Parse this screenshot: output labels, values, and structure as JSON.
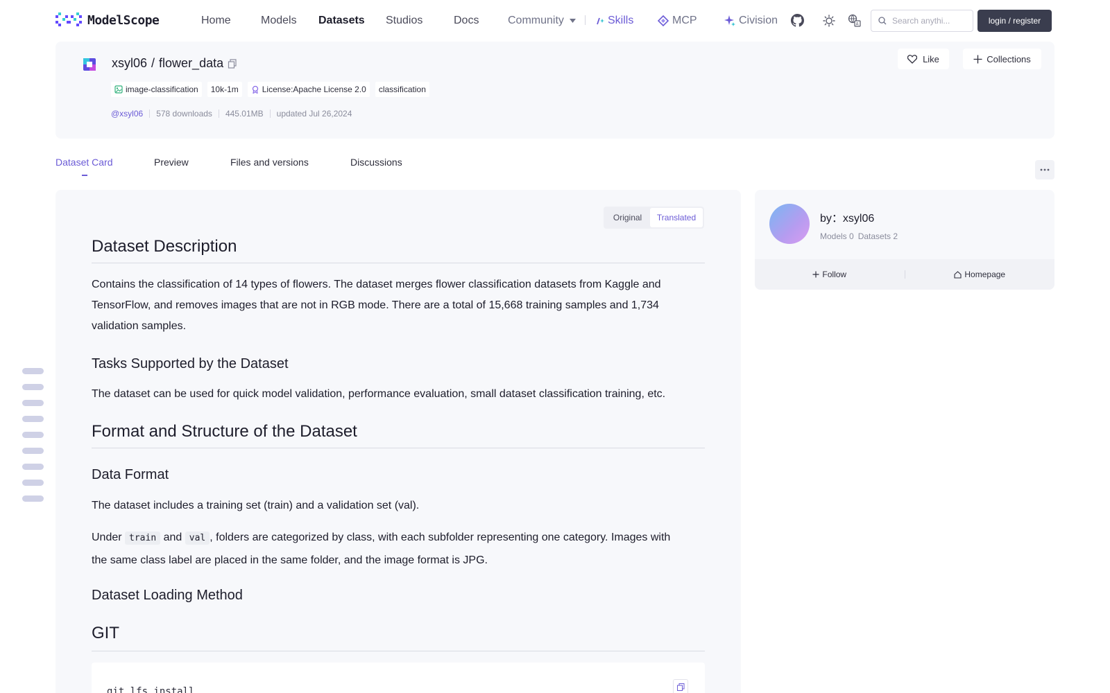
{
  "header": {
    "logo_text": "ModelScope",
    "nav": [
      {
        "label": "Home"
      },
      {
        "label": "Models"
      },
      {
        "label": "Datasets"
      },
      {
        "label": "Studios"
      },
      {
        "label": "Docs"
      },
      {
        "label": "Community"
      }
    ],
    "skills_label": "Skills",
    "mcp_label": "MCP",
    "civision_label": "Civision",
    "search_placeholder": "Search anythi...",
    "login_label": "login / register"
  },
  "repo": {
    "owner": "xsyl06",
    "separator": "/",
    "name": "flower_data",
    "tags": [
      {
        "label": "image-classification"
      },
      {
        "label": "10k-1m"
      },
      {
        "label": "License:Apache License 2.0"
      },
      {
        "label": "classification"
      }
    ],
    "author_handle": "@xsyl06",
    "downloads": "578 downloads",
    "size": "445.01MB",
    "updated": "updated Jul 26,2024",
    "like_label": "Like",
    "collections_label": "Collections"
  },
  "tabs": [
    {
      "label": "Dataset Card"
    },
    {
      "label": "Preview"
    },
    {
      "label": "Files and versions"
    },
    {
      "label": "Discussions"
    }
  ],
  "toggle": {
    "original": "Original",
    "translated": "Translated"
  },
  "doc": {
    "h_description": "Dataset Description",
    "p_description": "Contains the classification of 14 types of flowers. The dataset merges flower classification datasets from Kaggle and TensorFlow, and removes images that are not in RGB mode. There are a total of 15,668 training samples and 1,734 validation samples.",
    "h_tasks": "Tasks Supported by the Dataset",
    "p_tasks": "The dataset can be used for quick model validation, performance evaluation, small dataset classification training, etc.",
    "h_format": "Format and Structure of the Dataset",
    "h_data_format": "Data Format",
    "p_data_format": "The dataset includes a training set (train) and a validation set (val).",
    "p_under_1": "Under ",
    "code_train": "train",
    "p_under_2": " and ",
    "code_val": "val",
    "p_under_3": ", folders are categorized by class, with each subfolder representing one category. Images with the same class label are placed in the same folder, and the image format is JPG.",
    "h_loading": "Dataset Loading Method",
    "h_git": "GIT",
    "code_line": "git lfs install"
  },
  "author_card": {
    "by_label": "by：xsyl06",
    "models": "Models 0",
    "datasets": "Datasets 2",
    "follow_label": "Follow",
    "homepage_label": "Homepage"
  },
  "colors": {
    "accent": "#6b5bd6",
    "panel_bg": "#f7f8fb",
    "login_bg": "#3a3d4e"
  },
  "icons": [
    "logo-mark",
    "copy-icon",
    "tag-icon",
    "license-icon",
    "heart-icon",
    "plus-icon",
    "sparkle-icon",
    "mcp-icon",
    "github-icon",
    "sun-icon",
    "language-icon",
    "search-icon",
    "more-icon",
    "home-icon"
  ]
}
